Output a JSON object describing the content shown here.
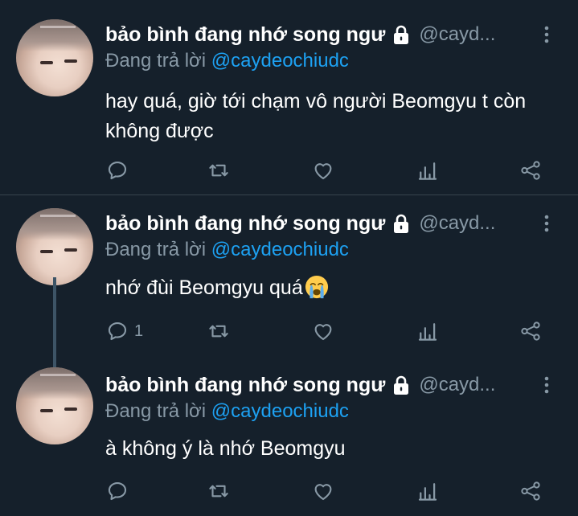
{
  "tweets": [
    {
      "name": "bảo bình đang nhớ song ngư",
      "handle": "@cayd...",
      "replying_prefix": "Đang trả lời",
      "replying_to": "@caydeochiudc",
      "text": "hay quá, giờ tới chạm vô người Beomgyu t còn không được",
      "reply_count": ""
    },
    {
      "name": "bảo bình đang nhớ song ngư",
      "handle": "@cayd...",
      "replying_prefix": "Đang trả lời",
      "replying_to": "@caydeochiudc",
      "text": "nhớ đùi Beomgyu quá",
      "emoji": "loudly-crying-face",
      "reply_count": "1"
    },
    {
      "name": "bảo bình đang nhớ song ngư",
      "handle": "@cayd...",
      "replying_prefix": "Đang trả lời",
      "replying_to": "@caydeochiudc",
      "text": "à không ý là nhớ Beomgyu",
      "reply_count": ""
    }
  ],
  "icons": [
    "lock-icon",
    "more-menu-icon",
    "reply-icon",
    "retweet-icon",
    "like-icon",
    "stats-icon",
    "share-icon"
  ],
  "colors": {
    "background": "#15202b",
    "text": "#ffffff",
    "muted": "#8899a6",
    "link": "#1da1f2",
    "divider": "#38444d"
  }
}
